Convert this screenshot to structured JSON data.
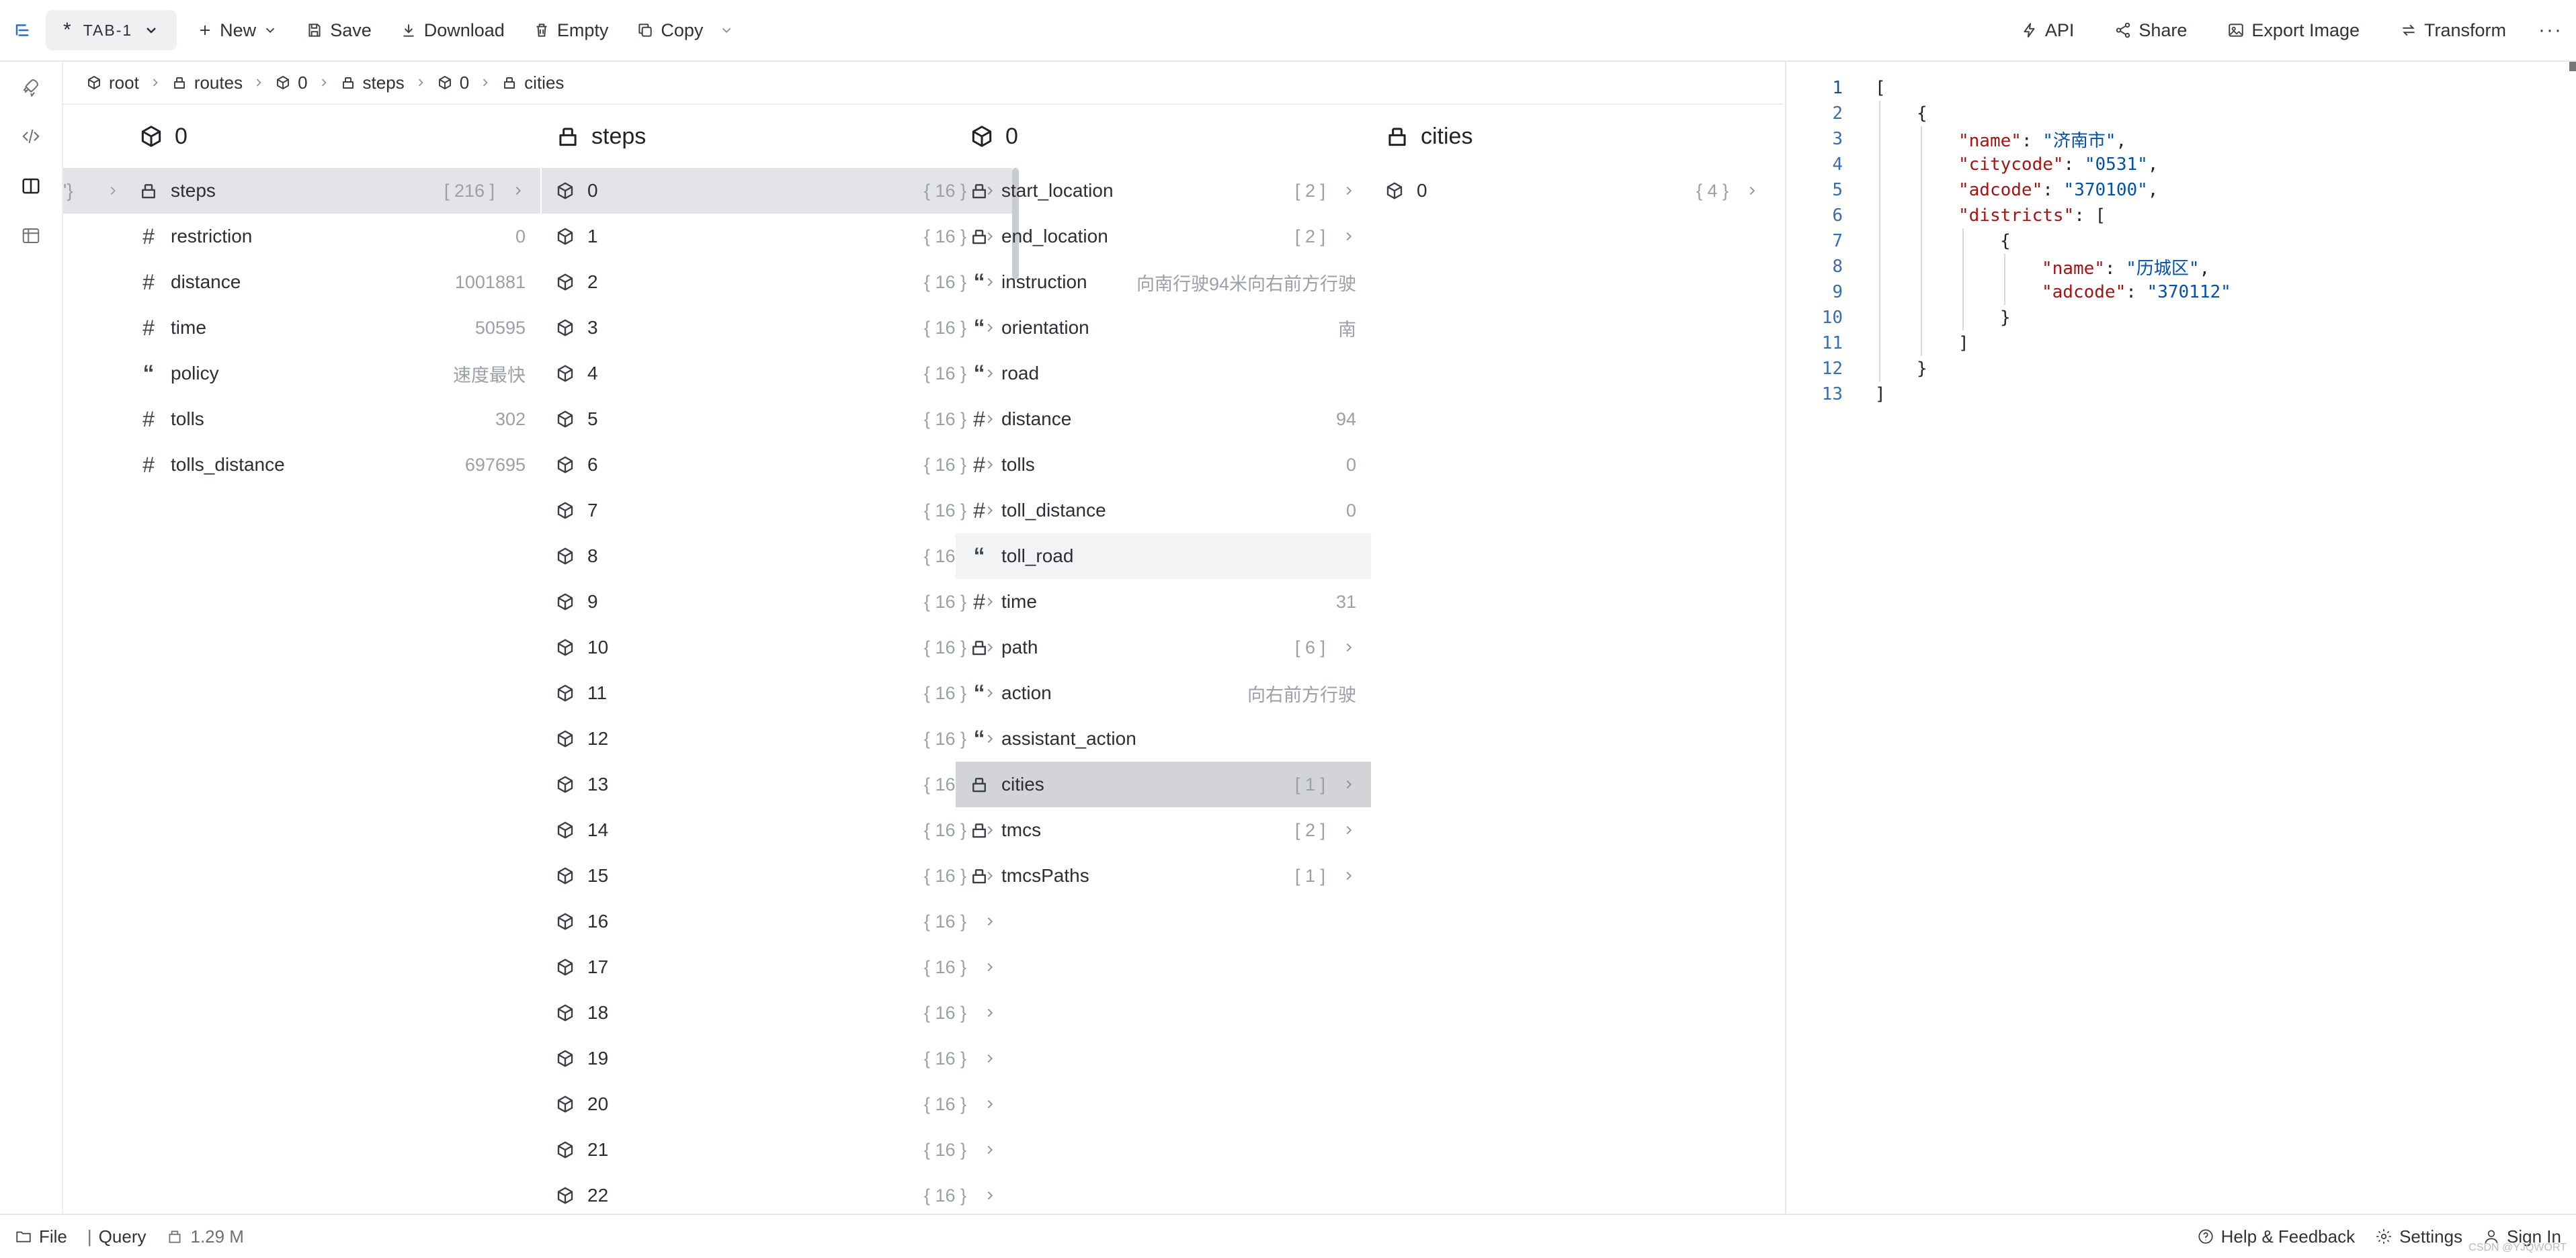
{
  "toolbar": {
    "tab_label": "TAB-1",
    "tab_modified_mark": "*",
    "new_label": "New",
    "save_label": "Save",
    "download_label": "Download",
    "empty_label": "Empty",
    "copy_label": "Copy",
    "api_label": "API",
    "share_label": "Share",
    "export_label": "Export Image",
    "transform_label": "Transform"
  },
  "breadcrumb": [
    {
      "label": "root",
      "icon": "cube-icon"
    },
    {
      "label": "routes",
      "icon": "array-icon"
    },
    {
      "label": "0",
      "icon": "cube-icon"
    },
    {
      "label": "steps",
      "icon": "array-icon"
    },
    {
      "label": "0",
      "icon": "cube-icon"
    },
    {
      "label": "cities",
      "icon": "array-icon"
    }
  ],
  "columns": [
    {
      "title": "0",
      "icon": "cube",
      "peek": "'}",
      "rows": [
        {
          "icon": "array",
          "label": "steps",
          "value": "[ 216 ]",
          "chev": true,
          "state": "sel"
        },
        {
          "icon": "hash",
          "label": "restriction",
          "value": "0"
        },
        {
          "icon": "hash",
          "label": "distance",
          "value": "1001881"
        },
        {
          "icon": "hash",
          "label": "time",
          "value": "50595"
        },
        {
          "icon": "quote",
          "label": "policy",
          "value": "速度最快"
        },
        {
          "icon": "hash",
          "label": "tolls",
          "value": "302"
        },
        {
          "icon": "hash",
          "label": "tolls_distance",
          "value": "697695"
        }
      ]
    },
    {
      "title": "steps",
      "icon": "array",
      "rows": [
        {
          "icon": "cube",
          "label": "0",
          "value": "{ 16 }",
          "chev": true,
          "state": "sel"
        },
        {
          "icon": "cube",
          "label": "1",
          "value": "{ 16 }",
          "chev": true
        },
        {
          "icon": "cube",
          "label": "2",
          "value": "{ 16 }",
          "chev": true
        },
        {
          "icon": "cube",
          "label": "3",
          "value": "{ 16 }",
          "chev": true
        },
        {
          "icon": "cube",
          "label": "4",
          "value": "{ 16 }",
          "chev": true
        },
        {
          "icon": "cube",
          "label": "5",
          "value": "{ 16 }",
          "chev": true
        },
        {
          "icon": "cube",
          "label": "6",
          "value": "{ 16 }",
          "chev": true
        },
        {
          "icon": "cube",
          "label": "7",
          "value": "{ 16 }",
          "chev": true
        },
        {
          "icon": "cube",
          "label": "8",
          "value": "{ 16 }",
          "chev": true
        },
        {
          "icon": "cube",
          "label": "9",
          "value": "{ 16 }",
          "chev": true
        },
        {
          "icon": "cube",
          "label": "10",
          "value": "{ 16 }",
          "chev": true
        },
        {
          "icon": "cube",
          "label": "11",
          "value": "{ 16 }",
          "chev": true
        },
        {
          "icon": "cube",
          "label": "12",
          "value": "{ 16 }",
          "chev": true
        },
        {
          "icon": "cube",
          "label": "13",
          "value": "{ 16 }",
          "chev": true
        },
        {
          "icon": "cube",
          "label": "14",
          "value": "{ 16 }",
          "chev": true
        },
        {
          "icon": "cube",
          "label": "15",
          "value": "{ 16 }",
          "chev": true
        },
        {
          "icon": "cube",
          "label": "16",
          "value": "{ 16 }",
          "chev": true
        },
        {
          "icon": "cube",
          "label": "17",
          "value": "{ 16 }",
          "chev": true
        },
        {
          "icon": "cube",
          "label": "18",
          "value": "{ 16 }",
          "chev": true
        },
        {
          "icon": "cube",
          "label": "19",
          "value": "{ 16 }",
          "chev": true
        },
        {
          "icon": "cube",
          "label": "20",
          "value": "{ 16 }",
          "chev": true
        },
        {
          "icon": "cube",
          "label": "21",
          "value": "{ 16 }",
          "chev": true
        },
        {
          "icon": "cube",
          "label": "22",
          "value": "{ 16 }",
          "chev": true
        }
      ]
    },
    {
      "title": "0",
      "icon": "cube",
      "rows": [
        {
          "icon": "array",
          "label": "start_location",
          "value": "[ 2 ]",
          "chev": true
        },
        {
          "icon": "array",
          "label": "end_location",
          "value": "[ 2 ]",
          "chev": true
        },
        {
          "icon": "quote",
          "label": "instruction",
          "value": "向南行驶94米向右前方行驶"
        },
        {
          "icon": "quote",
          "label": "orientation",
          "value": "南"
        },
        {
          "icon": "quote",
          "label": "road",
          "value": ""
        },
        {
          "icon": "hash",
          "label": "distance",
          "value": "94"
        },
        {
          "icon": "hash",
          "label": "tolls",
          "value": "0"
        },
        {
          "icon": "hash",
          "label": "toll_distance",
          "value": "0"
        },
        {
          "icon": "quote",
          "label": "toll_road",
          "value": "",
          "state": "soft"
        },
        {
          "icon": "hash",
          "label": "time",
          "value": "31"
        },
        {
          "icon": "array",
          "label": "path",
          "value": "[ 6 ]",
          "chev": true
        },
        {
          "icon": "quote",
          "label": "action",
          "value": "向右前方行驶"
        },
        {
          "icon": "quote",
          "label": "assistant_action",
          "value": ""
        },
        {
          "icon": "array",
          "label": "cities",
          "value": "[ 1 ]",
          "chev": true,
          "state": "sel-strong"
        },
        {
          "icon": "array",
          "label": "tmcs",
          "value": "[ 2 ]",
          "chev": true
        },
        {
          "icon": "array",
          "label": "tmcsPaths",
          "value": "[ 1 ]",
          "chev": true
        }
      ]
    },
    {
      "title": "cities",
      "icon": "array",
      "rows": [
        {
          "icon": "cube",
          "label": "0",
          "value": "{ 4 }",
          "chev": true
        }
      ]
    }
  ],
  "code": [
    {
      "n": "1",
      "indent": 0,
      "parts": [
        [
          "p",
          "["
        ]
      ]
    },
    {
      "n": "2",
      "indent": 1,
      "parts": [
        [
          "p",
          "{"
        ]
      ]
    },
    {
      "n": "3",
      "indent": 2,
      "parts": [
        [
          "k",
          "\"name\""
        ],
        [
          "p",
          ": "
        ],
        [
          "s",
          "\"济南市\""
        ],
        [
          "p",
          ","
        ]
      ]
    },
    {
      "n": "4",
      "indent": 2,
      "parts": [
        [
          "k",
          "\"citycode\""
        ],
        [
          "p",
          ": "
        ],
        [
          "s",
          "\"0531\""
        ],
        [
          "p",
          ","
        ]
      ]
    },
    {
      "n": "5",
      "indent": 2,
      "parts": [
        [
          "k",
          "\"adcode\""
        ],
        [
          "p",
          ": "
        ],
        [
          "s",
          "\"370100\""
        ],
        [
          "p",
          ","
        ]
      ]
    },
    {
      "n": "6",
      "indent": 2,
      "parts": [
        [
          "k",
          "\"districts\""
        ],
        [
          "p",
          ": ["
        ]
      ]
    },
    {
      "n": "7",
      "indent": 3,
      "parts": [
        [
          "p",
          "{"
        ]
      ]
    },
    {
      "n": "8",
      "indent": 4,
      "parts": [
        [
          "k",
          "\"name\""
        ],
        [
          "p",
          ": "
        ],
        [
          "s",
          "\"历城区\""
        ],
        [
          "p",
          ","
        ]
      ]
    },
    {
      "n": "9",
      "indent": 4,
      "parts": [
        [
          "k",
          "\"adcode\""
        ],
        [
          "p",
          ": "
        ],
        [
          "s",
          "\"370112\""
        ]
      ]
    },
    {
      "n": "10",
      "indent": 3,
      "parts": [
        [
          "p",
          "}"
        ]
      ]
    },
    {
      "n": "11",
      "indent": 2,
      "parts": [
        [
          "p",
          "]"
        ]
      ]
    },
    {
      "n": "12",
      "indent": 1,
      "parts": [
        [
          "p",
          "}"
        ]
      ]
    },
    {
      "n": "13",
      "indent": 0,
      "parts": [
        [
          "p",
          "]"
        ]
      ]
    }
  ],
  "status": {
    "file_label": "File",
    "query_label": "Query",
    "size_label": "1.29 M",
    "help_label": "Help & Feedback",
    "settings_label": "Settings",
    "signin_label": "Sign In",
    "watermark": "CSDN @YJQWORT"
  }
}
